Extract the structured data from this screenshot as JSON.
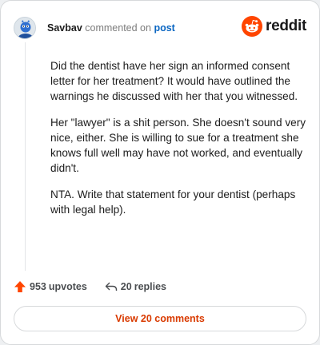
{
  "comment": {
    "username": "Savbav",
    "verb": "commented on",
    "post_link": "post",
    "paragraphs": [
      "Did the dentist have her sign an informed consent letter for her treatment? It would have outlined the warnings he discussed with her that you witnessed.",
      "Her \"lawyer\" is a shit person. She doesn't sound very nice, either. She is willing to sue for a treatment she knows full well may have not worked, and eventually didn't.",
      "NTA. Write that statement for your dentist (perhaps with legal help)."
    ]
  },
  "brand": {
    "wordmark": "reddit",
    "icon": "reddit-snoo-icon",
    "color": "#ff4500"
  },
  "actions": {
    "upvotes_count": "953",
    "upvotes_label": "upvotes",
    "upvote_icon": "upvote-arrow-icon",
    "upvote_color": "#ff4500",
    "replies_count": "20",
    "replies_label": "replies",
    "reply_icon": "reply-arrow-icon"
  },
  "view_comments_button": "View 20 comments",
  "colors": {
    "accent": "#d93a00",
    "link": "#0a66c2"
  }
}
